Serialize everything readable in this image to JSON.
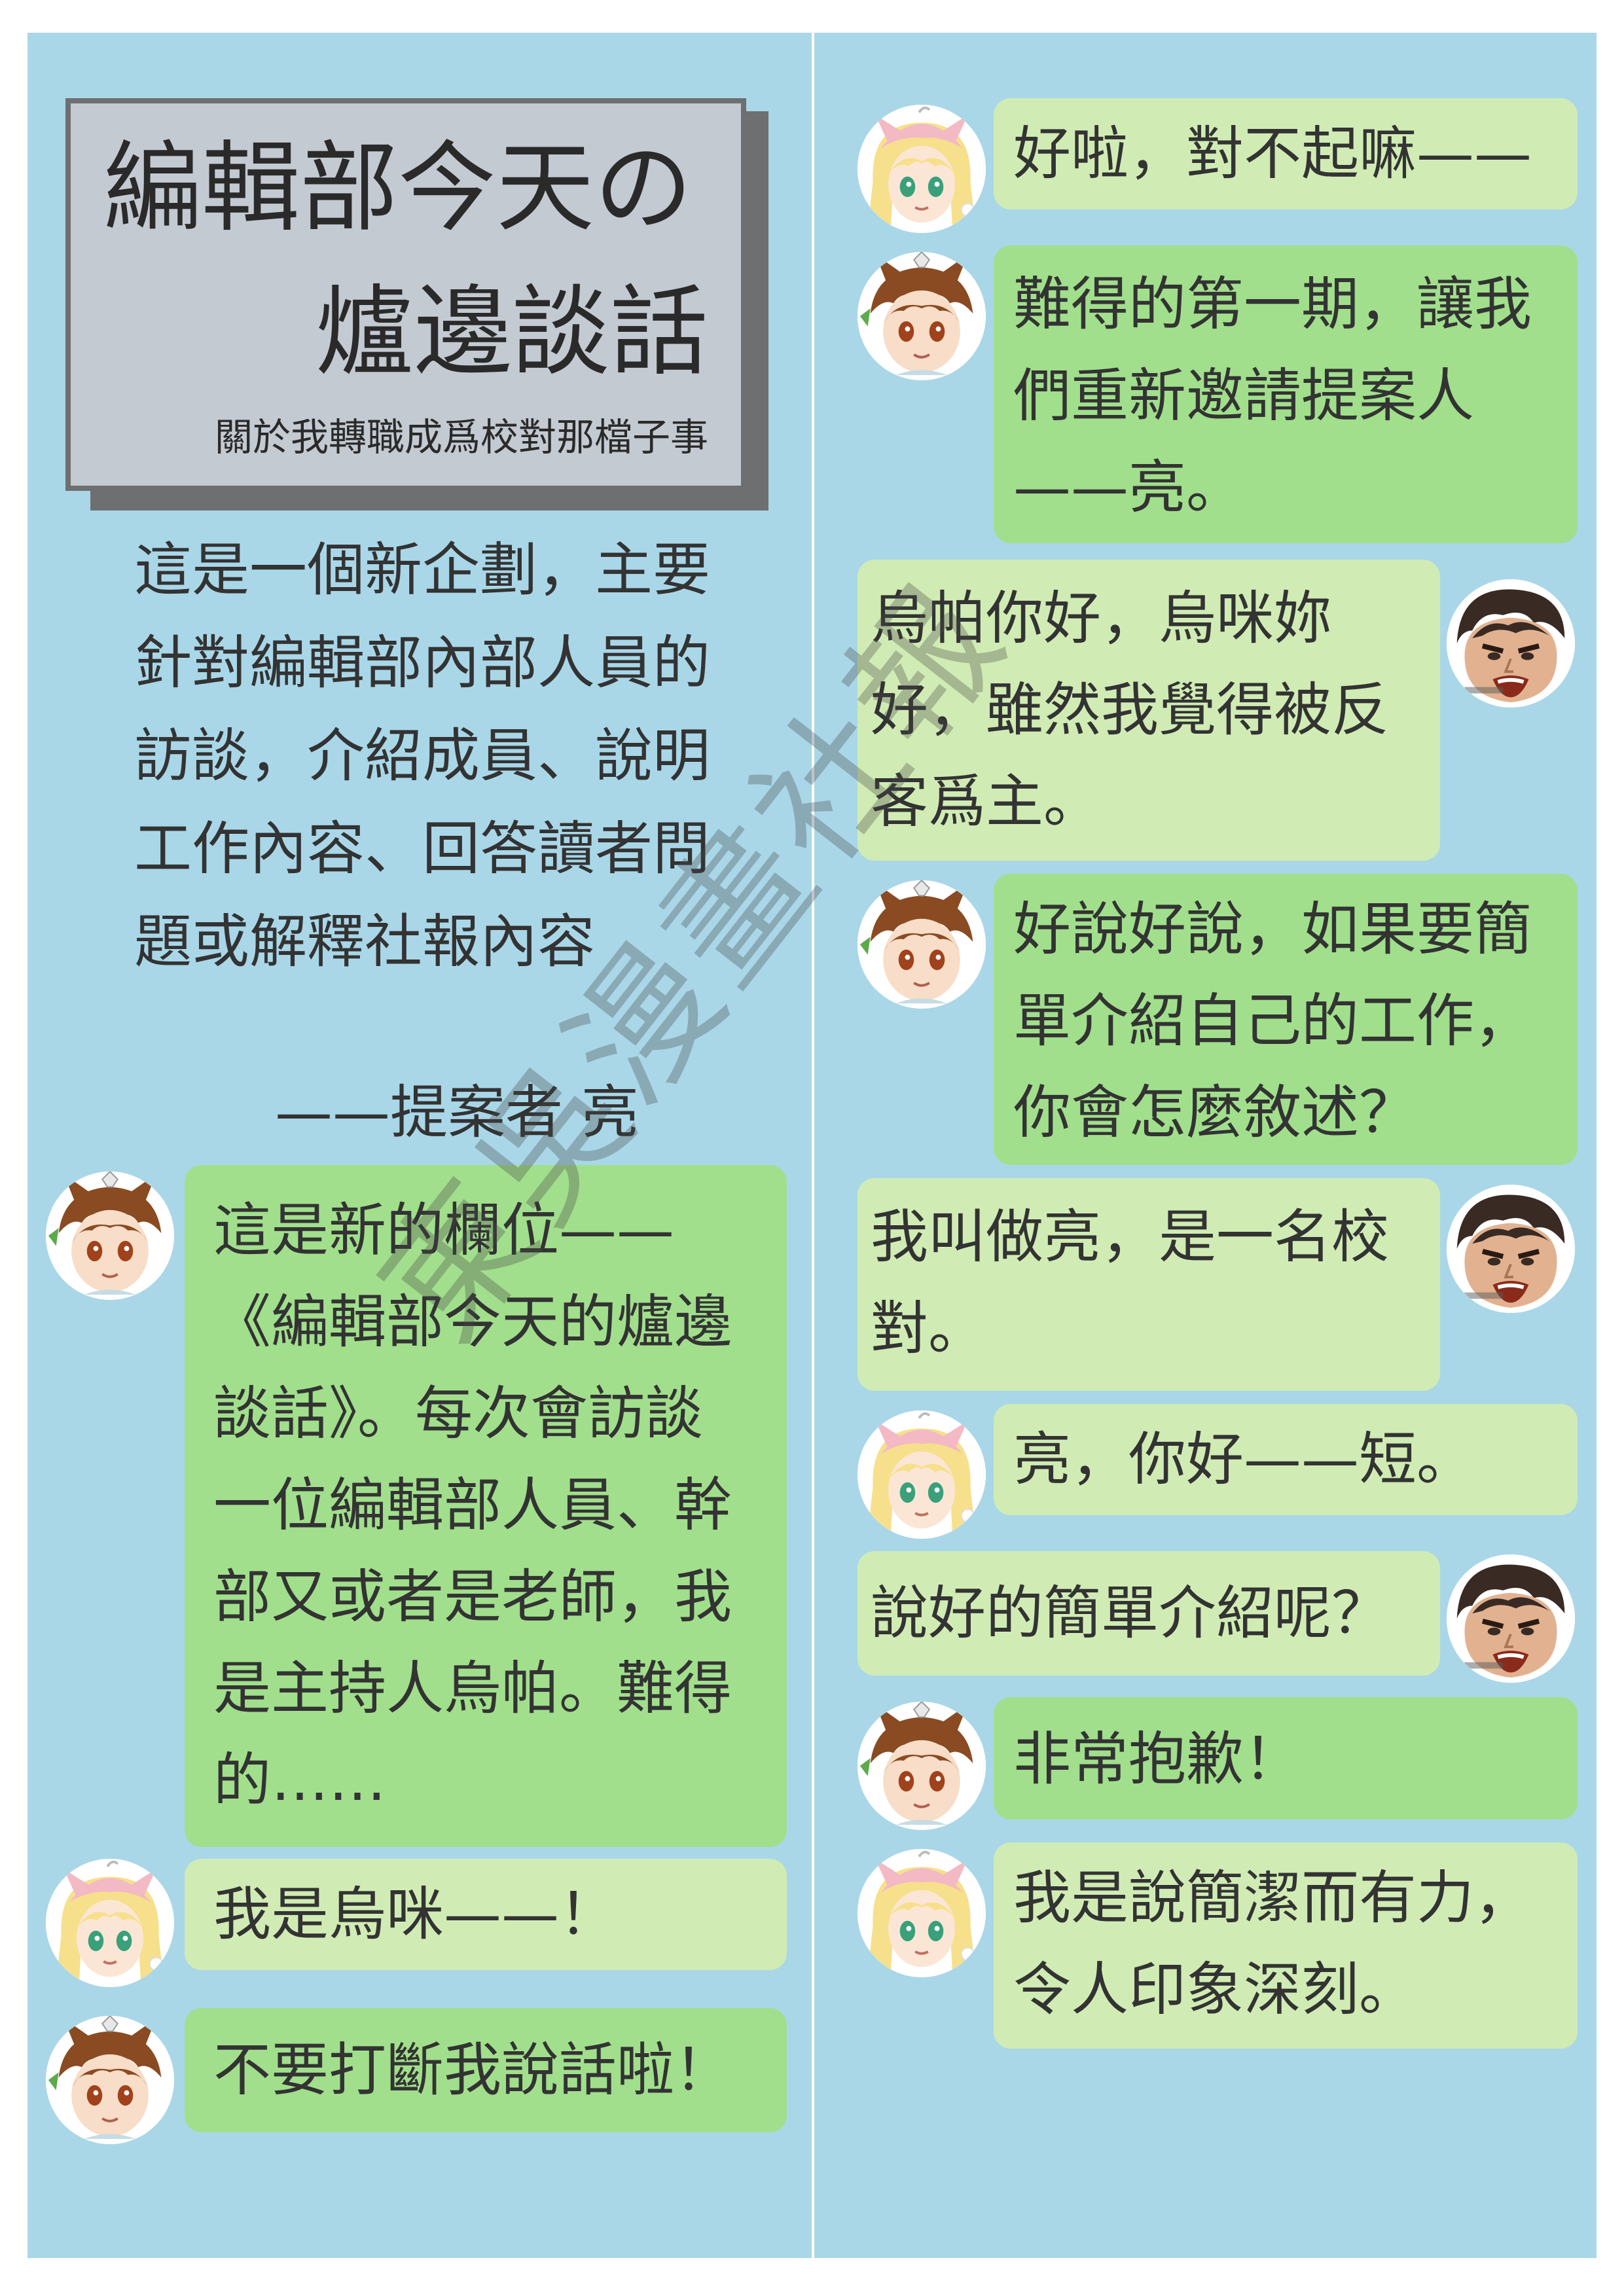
{
  "title": {
    "line1": "編輯部今天の",
    "line2": "爐邊談話",
    "subtitle": "關於我轉職成爲校對那檔子事"
  },
  "intro": {
    "text": "這是一個新企劃，主要針對編輯部內部人員的訪談，介紹成員、說明工作內容、回答讀者問題或解釋社報內容",
    "signature": "——提案者 亮"
  },
  "watermark": "東吳漫畫社報",
  "characters": {
    "wupa": "烏帕",
    "wumi": "烏咪",
    "liang": "亮"
  },
  "messages_left": [
    {
      "speaker": "wupa",
      "text": "這是新的欄位——《編輯部今天的爐邊談話》。每次會訪談一位編輯部人員、幹部又或者是老師，我是主持人烏帕。難得的……"
    },
    {
      "speaker": "wumi",
      "text": "我是烏咪——！"
    },
    {
      "speaker": "wupa",
      "text": "不要打斷我說話啦！"
    }
  ],
  "messages_right": [
    {
      "speaker": "wumi",
      "text": "好啦，對不起嘛——"
    },
    {
      "speaker": "wupa",
      "text": "難得的第一期，讓我們重新邀請提案人——亮。"
    },
    {
      "speaker": "liang",
      "text": "烏帕你好，烏咪妳好，雖然我覺得被反客爲主。"
    },
    {
      "speaker": "wupa",
      "text": "好說好說，如果要簡單介紹自己的工作，你會怎麼敘述？"
    },
    {
      "speaker": "liang",
      "text": "我叫做亮，是一名校對。"
    },
    {
      "speaker": "wumi",
      "text": "亮，你好——短。"
    },
    {
      "speaker": "liang",
      "text": "說好的簡單介紹呢？"
    },
    {
      "speaker": "wupa",
      "text": "非常抱歉！"
    },
    {
      "speaker": "wumi",
      "text": "我是說簡潔而有力，令人印象深刻。"
    }
  ],
  "colors": {
    "panel": "#a9d7e8",
    "bubble_green": "#a1df8c",
    "bubble_light": "#d0ecb4",
    "title_box": "#c4cad2",
    "title_border": "#6e6f71"
  }
}
